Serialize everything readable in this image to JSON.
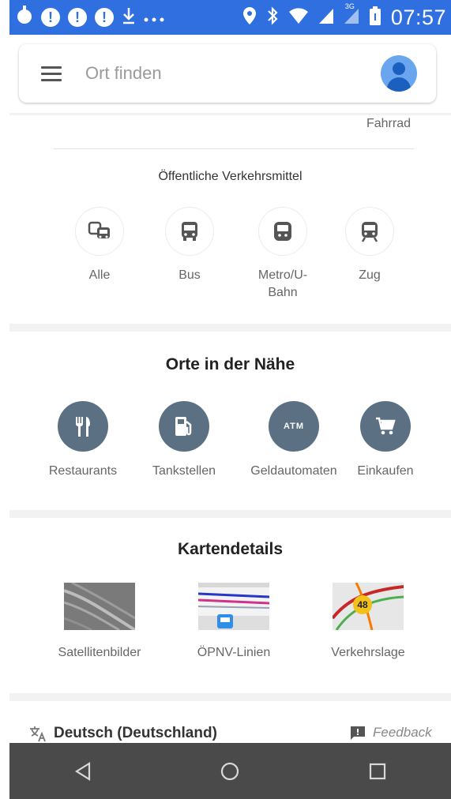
{
  "status_bar": {
    "time": "07:57",
    "network_label": "3G",
    "icons": [
      "touch-icon",
      "alert-icon",
      "alert-icon",
      "alert-icon",
      "download-icon",
      "more-icon",
      "location-icon",
      "bluetooth-icon",
      "wifi-icon",
      "signal-icon",
      "signal-3g-icon",
      "battery-icon"
    ]
  },
  "search": {
    "placeholder": "Ort finden"
  },
  "travel_modes": {
    "bike_label": "Fahrrad"
  },
  "transit": {
    "heading": "Öffentliche Verkehrsmittel",
    "items": [
      {
        "label": "Alle",
        "icon": "transit-all-icon"
      },
      {
        "label": "Bus",
        "icon": "bus-icon"
      },
      {
        "label": "Metro/U-Bahn",
        "icon": "subway-icon"
      },
      {
        "label": "Zug",
        "icon": "train-icon"
      }
    ]
  },
  "nearby": {
    "heading": "Orte in der Nähe",
    "items": [
      {
        "label": "Restaurants",
        "icon": "restaurant-icon"
      },
      {
        "label": "Tankstellen",
        "icon": "gas-station-icon"
      },
      {
        "label": "Geldautomaten",
        "icon": "atm-icon",
        "icon_text": "ATM"
      },
      {
        "label": "Einkaufen",
        "icon": "shopping-cart-icon"
      }
    ],
    "icon_color": "#5b7083"
  },
  "map_details": {
    "heading": "Kartendetails",
    "items": [
      {
        "label": "Satellitenbilder"
      },
      {
        "label": "ÖPNV-Linien"
      },
      {
        "label": "Verkehrslage",
        "badge": "48"
      }
    ]
  },
  "footer": {
    "language": "Deutsch (Deutschland)",
    "feedback": "Feedback"
  },
  "colors": {
    "status_bar": "#2f6fe0",
    "nav_bar": "#4a4a4a",
    "accent_avatar": "#6aa6f0"
  }
}
